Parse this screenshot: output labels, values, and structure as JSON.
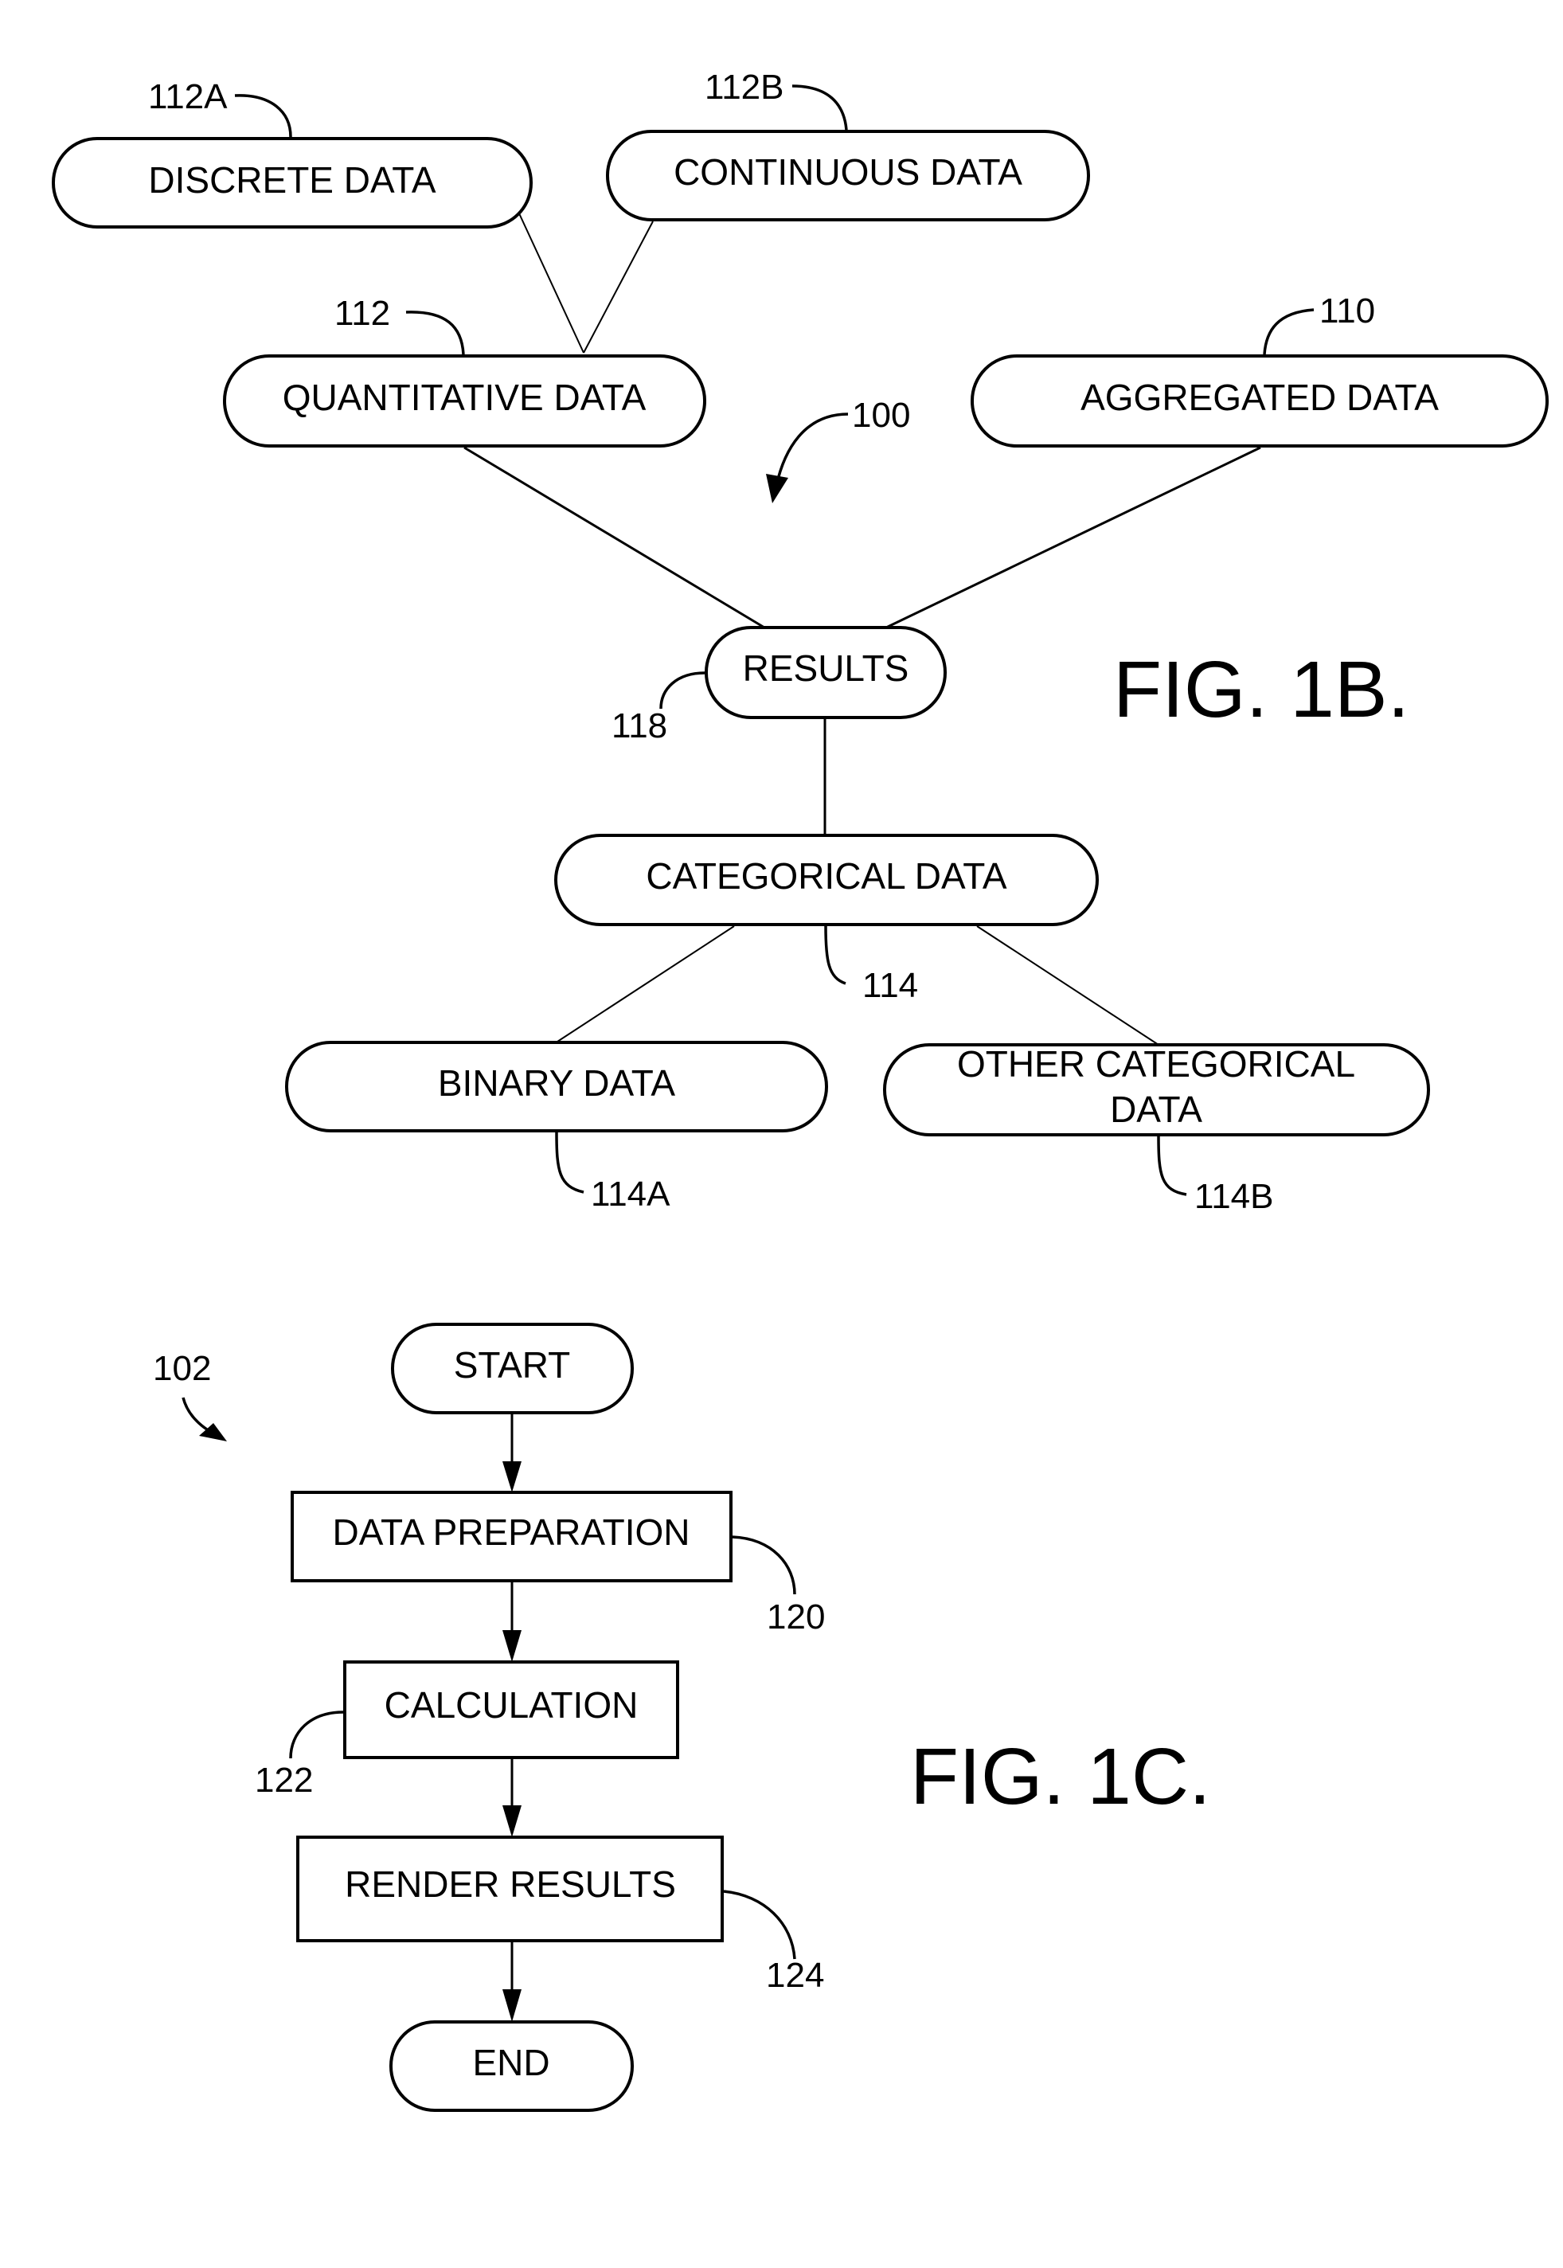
{
  "figures": [
    {
      "id": "fig1b",
      "title": "FIG. 1B.",
      "reference": "100",
      "nodes": {
        "discrete": {
          "label": "DISCRETE DATA",
          "ref": "112A"
        },
        "continuous": {
          "label": "CONTINUOUS DATA",
          "ref": "112B"
        },
        "quantitative": {
          "label": "QUANTITATIVE DATA",
          "ref": "112"
        },
        "aggregated": {
          "label": "AGGREGATED DATA",
          "ref": "110"
        },
        "results": {
          "label": "RESULTS",
          "ref": "118"
        },
        "categorical": {
          "label": "CATEGORICAL DATA",
          "ref": "114"
        },
        "binary": {
          "label": "BINARY DATA",
          "ref": "114A"
        },
        "other_categorical": {
          "label_line1": "OTHER CATEGORICAL",
          "label_line2": "DATA",
          "ref": "114B"
        }
      },
      "edges": [
        [
          "discrete",
          "quantitative"
        ],
        [
          "continuous",
          "quantitative"
        ],
        [
          "quantitative",
          "results"
        ],
        [
          "aggregated",
          "results"
        ],
        [
          "results",
          "categorical"
        ],
        [
          "categorical",
          "binary"
        ],
        [
          "categorical",
          "other_categorical"
        ]
      ]
    },
    {
      "id": "fig1c",
      "title": "FIG. 1C.",
      "reference": "102",
      "steps": {
        "start": {
          "label": "START"
        },
        "data_preparation": {
          "label": "DATA PREPARATION",
          "ref": "120"
        },
        "calculation": {
          "label": "CALCULATION",
          "ref": "122"
        },
        "render_results": {
          "label": "RENDER RESULTS",
          "ref": "124"
        },
        "end": {
          "label": "END"
        }
      },
      "flow": [
        "start",
        "data_preparation",
        "calculation",
        "render_results",
        "end"
      ]
    }
  ]
}
